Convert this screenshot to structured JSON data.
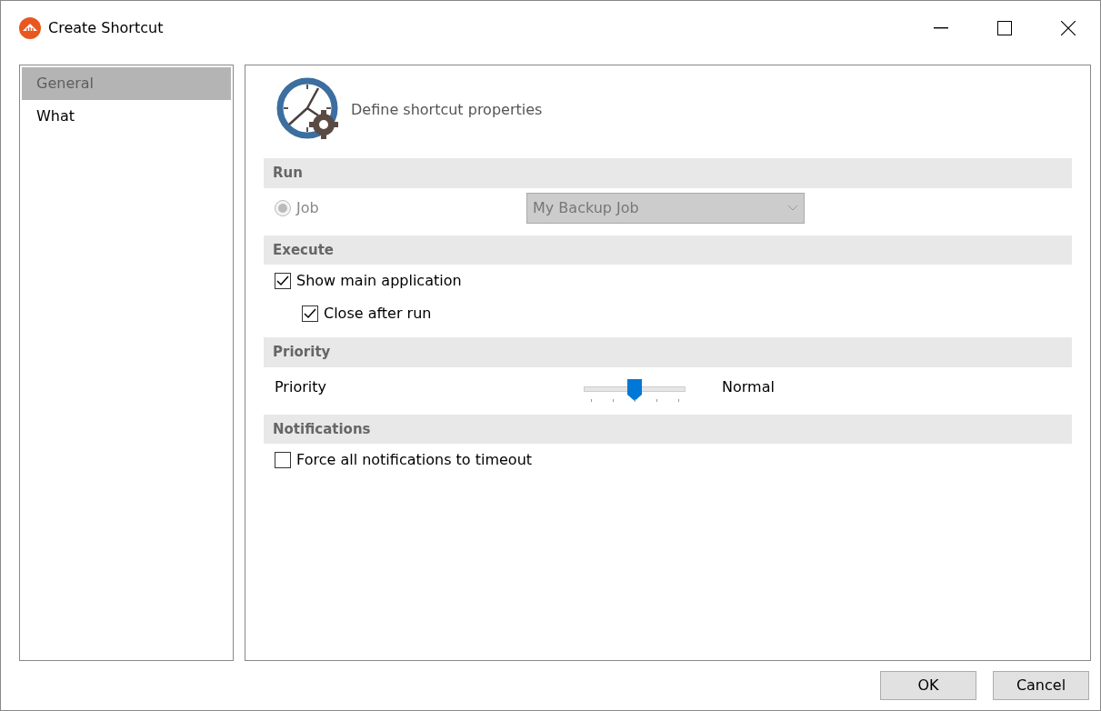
{
  "window": {
    "title": "Create Shortcut"
  },
  "sidebar": {
    "items": [
      {
        "label": "General",
        "selected": true
      },
      {
        "label": "What",
        "selected": false
      }
    ]
  },
  "header": {
    "text": "Define shortcut properties"
  },
  "sections": [
    {
      "title": "Run",
      "rows": [
        {
          "kind": "radio",
          "label": "Job",
          "checked": true,
          "disabled": true,
          "dropdown": {
            "value": "My Backup Job",
            "disabled": true
          }
        }
      ]
    },
    {
      "title": "Execute",
      "rows": [
        {
          "kind": "checkbox",
          "label": "Show main application",
          "checked": true,
          "indented": false
        },
        {
          "kind": "checkbox",
          "label": "Close after run",
          "checked": true,
          "indented": true
        }
      ]
    },
    {
      "title": "Priority",
      "rows": [
        {
          "kind": "slider",
          "label": "Priority",
          "level": 0.5,
          "reading": "Normal"
        }
      ]
    },
    {
      "title": "Notifications",
      "rows": [
        {
          "kind": "checkbox",
          "label": "Force all notifications to timeout",
          "checked": false,
          "indented": false
        }
      ]
    }
  ],
  "buttons": [
    "OK",
    "Cancel"
  ]
}
